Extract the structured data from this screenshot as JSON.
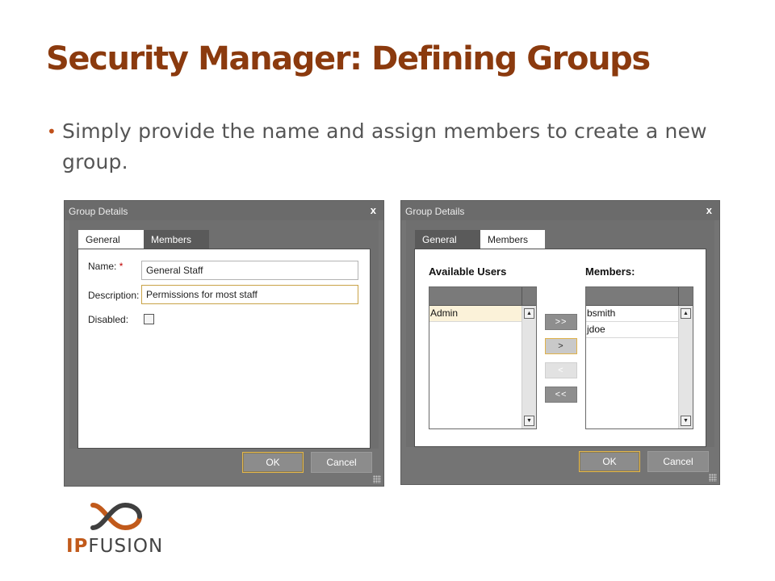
{
  "slide": {
    "title": "Security Manager: Defining Groups",
    "bullet": "Simply provide the name and assign members to create a new group."
  },
  "dialog_general": {
    "title": "Group Details",
    "close_glyph": "x",
    "tabs": {
      "general": "General",
      "members": "Members"
    },
    "fields": {
      "name_label": "Name:",
      "name_required": "*",
      "name_value": "General Staff",
      "description_label": "Description:",
      "description_value": "Permissions for most staff",
      "disabled_label": "Disabled:",
      "disabled_checked": false
    },
    "ok": "OK",
    "cancel": "Cancel"
  },
  "dialog_members": {
    "title": "Group Details",
    "close_glyph": "x",
    "tabs": {
      "general": "General",
      "members": "Members"
    },
    "available_label": "Available Users",
    "members_label": "Members:",
    "available_users": [
      "Admin"
    ],
    "members": [
      "bsmith",
      "jdoe"
    ],
    "move_buttons": {
      "add_all": ">>",
      "add": ">",
      "remove": "<",
      "remove_all": "<<"
    },
    "ok": "OK",
    "cancel": "Cancel"
  },
  "logo": {
    "ip": "IP",
    "fusion": "FUSION"
  },
  "colors": {
    "title": "#8b3a0e",
    "accent": "#c15a1b",
    "focus": "#e3b74d",
    "selection": "#fbf2d9"
  },
  "icons": {
    "close": "close-icon",
    "scroll_up": "scroll-up-icon",
    "scroll_down": "scroll-down-icon",
    "bullet": "bullet-icon"
  }
}
